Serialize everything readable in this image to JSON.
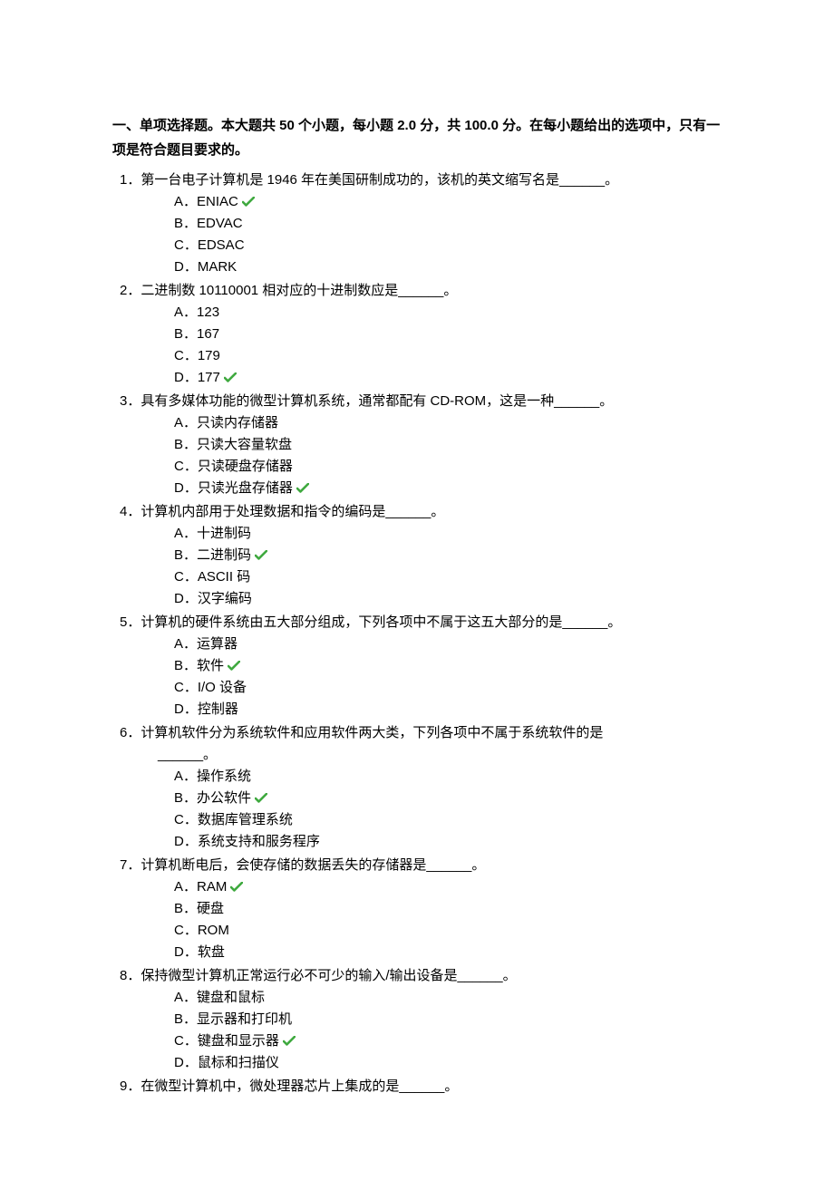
{
  "header": "一、单项选择题。本大题共 50 个小题，每小题  2.0  分，共 100.0 分。在每小题给出的选项中，只有一项是符合题目要求的。",
  "questions": [
    {
      "num": "1．",
      "stem": "第一台电子计算机是 1946 年在美国研制成功的，该机的英文缩写名是______。",
      "options": [
        {
          "label": "A．",
          "text": "ENIAC",
          "correct": true
        },
        {
          "label": "B．",
          "text": "EDVAC",
          "correct": false
        },
        {
          "label": "C．",
          "text": "EDSAC",
          "correct": false
        },
        {
          "label": "D．",
          "text": "MARK",
          "correct": false
        }
      ]
    },
    {
      "num": "2．",
      "stem": "二进制数 10110001 相对应的十进制数应是______。",
      "options": [
        {
          "label": "A．",
          "text": "123",
          "correct": false
        },
        {
          "label": "B．",
          "text": "167",
          "correct": false
        },
        {
          "label": "C．",
          "text": "179",
          "correct": false
        },
        {
          "label": "D．",
          "text": "177",
          "correct": true
        }
      ]
    },
    {
      "num": "3．",
      "stem": "具有多媒体功能的微型计算机系统，通常都配有 CD-ROM，这是一种______。",
      "options": [
        {
          "label": "A．",
          "text": "只读内存储器",
          "correct": false
        },
        {
          "label": "B．",
          "text": "只读大容量软盘",
          "correct": false
        },
        {
          "label": "C．",
          "text": "只读硬盘存储器",
          "correct": false
        },
        {
          "label": "D．",
          "text": "只读光盘存储器",
          "correct": true
        }
      ]
    },
    {
      "num": "4．",
      "stem": "计算机内部用于处理数据和指令的编码是______。",
      "options": [
        {
          "label": "A．",
          "text": "十进制码",
          "correct": false
        },
        {
          "label": "B．",
          "text": "二进制码",
          "correct": true
        },
        {
          "label": "C．",
          "text": "ASCII 码",
          "correct": false
        },
        {
          "label": "D．",
          "text": "汉字编码",
          "correct": false
        }
      ]
    },
    {
      "num": "5．",
      "stem": "计算机的硬件系统由五大部分组成，下列各项中不属于这五大部分的是______。",
      "options": [
        {
          "label": "A．",
          "text": "运算器",
          "correct": false
        },
        {
          "label": "B．",
          "text": "软件",
          "correct": true
        },
        {
          "label": "C．",
          "text": "I/O 设备",
          "correct": false
        },
        {
          "label": "D．",
          "text": "控制器",
          "correct": false
        }
      ]
    },
    {
      "num": "6．",
      "stem": "计算机软件分为系统软件和应用软件两大类，下列各项中不属于系统软件的是",
      "stem_cont": "______。",
      "options": [
        {
          "label": "A．",
          "text": "操作系统",
          "correct": false
        },
        {
          "label": "B．",
          "text": "办公软件",
          "correct": true
        },
        {
          "label": "C．",
          "text": "数据库管理系统",
          "correct": false
        },
        {
          "label": "D．",
          "text": "系统支持和服务程序",
          "correct": false
        }
      ]
    },
    {
      "num": "7．",
      "stem": "计算机断电后，会使存储的数据丢失的存储器是______。",
      "options": [
        {
          "label": "A．",
          "text": "RAM",
          "correct": true
        },
        {
          "label": "B．",
          "text": "硬盘",
          "correct": false
        },
        {
          "label": "C．",
          "text": "ROM",
          "correct": false
        },
        {
          "label": "D．",
          "text": "软盘",
          "correct": false
        }
      ]
    },
    {
      "num": "8．",
      "stem": "保持微型计算机正常运行必不可少的输入/输出设备是______。",
      "options": [
        {
          "label": "A．",
          "text": "键盘和鼠标",
          "correct": false
        },
        {
          "label": "B．",
          "text": "显示器和打印机",
          "correct": false
        },
        {
          "label": "C．",
          "text": "键盘和显示器",
          "correct": true
        },
        {
          "label": "D．",
          "text": "鼠标和扫描仪",
          "correct": false
        }
      ]
    },
    {
      "num": "9．",
      "stem": "在微型计算机中，微处理器芯片上集成的是______。",
      "options": []
    }
  ]
}
